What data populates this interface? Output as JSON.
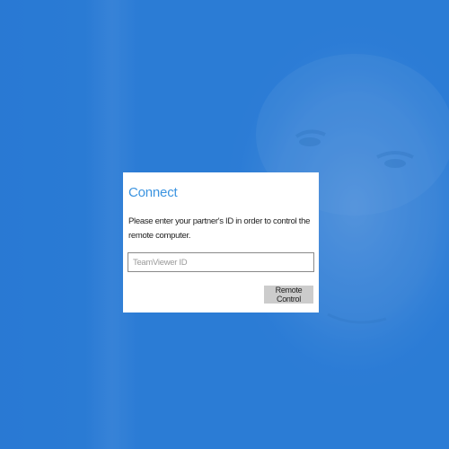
{
  "dialog": {
    "title": "Connect",
    "message": "Please enter your partner's ID in order to control the remote computer.",
    "id_input": {
      "placeholder": "TeamViewer ID",
      "value": ""
    },
    "button_label": "Remote Control"
  },
  "colors": {
    "overlay": "#2a7bd5",
    "title": "#3c94e0",
    "button_bg": "#cccccc"
  }
}
